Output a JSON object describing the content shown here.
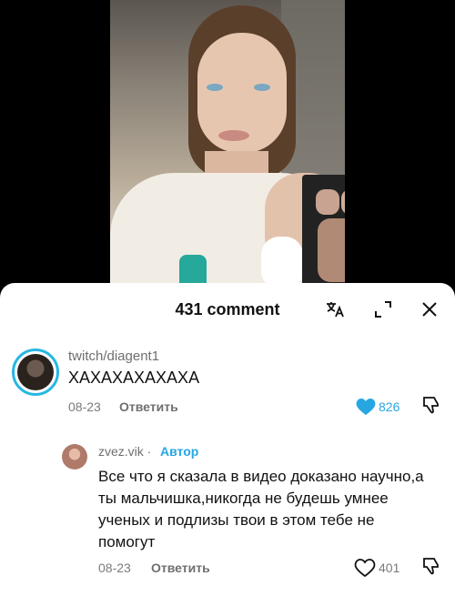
{
  "header": {
    "comment_count_label": "431 comment"
  },
  "icons": {
    "translate": "translate-icon",
    "expand": "expand-icon",
    "close": "close-icon"
  },
  "comments": [
    {
      "username": "twitch/diagent1",
      "text": "ХАХАХАХАХАХА",
      "date": "08-23",
      "reply_label": "Ответить",
      "likes": "826",
      "liked": true
    },
    {
      "username": "zvez.vik",
      "separator": " · ",
      "author_badge": "Автор",
      "text": "Все что я сказала в видео доказано научно,а ты мальчишка,никогда не будешь умнее ученых и подлизы твои в этом тебе не помогут",
      "date": "08-23",
      "reply_label": "Ответить",
      "likes": "401",
      "liked": false
    }
  ],
  "colors": {
    "accent": "#27a7e2",
    "like_active": "#27a7e2",
    "muted": "#6f6f6f"
  }
}
